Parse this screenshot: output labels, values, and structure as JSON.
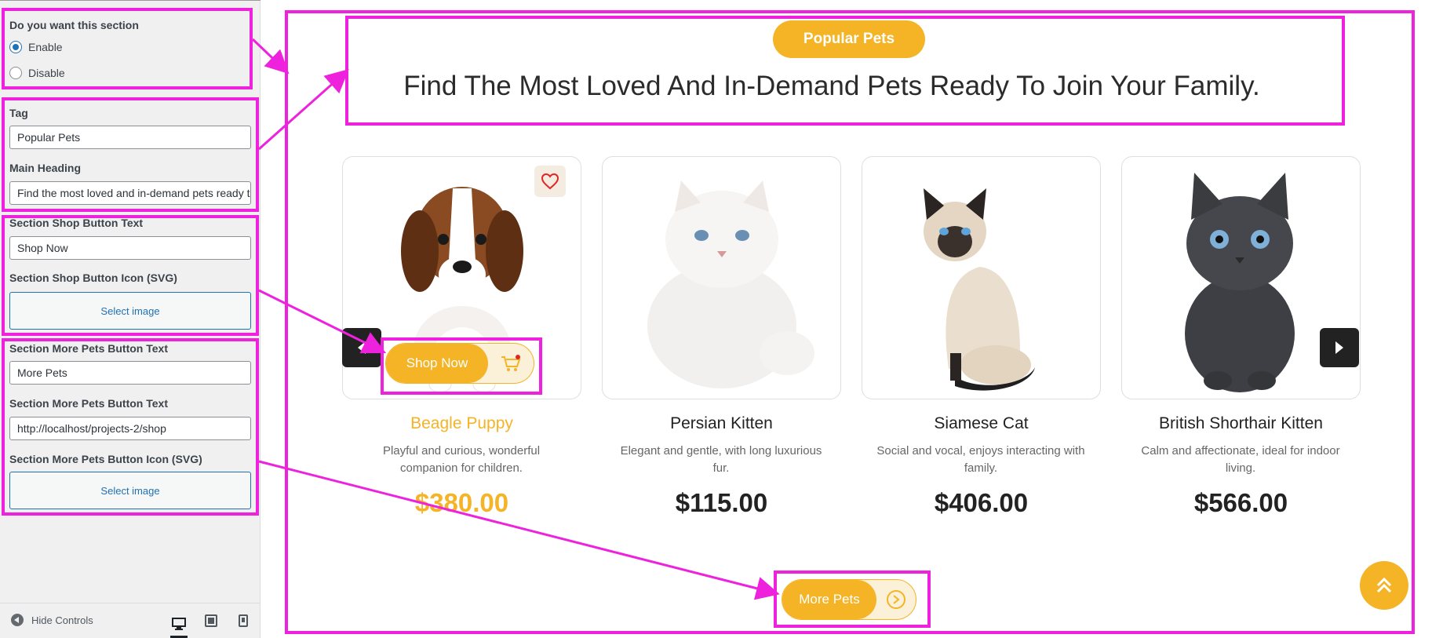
{
  "panel": {
    "section_toggle": {
      "label": "Do you want this section",
      "options": [
        "Enable",
        "Disable"
      ],
      "selected": "Enable"
    },
    "tag": {
      "label": "Tag",
      "value": "Popular Pets"
    },
    "main_heading": {
      "label": "Main Heading",
      "value": "Find the most loved and in-demand pets ready to join your family."
    },
    "shop_button_text": {
      "label": "Section Shop Button Text",
      "value": "Shop Now"
    },
    "shop_button_icon": {
      "label": "Section Shop Button Icon (SVG)",
      "button": "Select image"
    },
    "more_pets_text": {
      "label": "Section More Pets Button Text",
      "value": "More Pets"
    },
    "more_pets_url": {
      "label": "Section More Pets Button Text",
      "value": "http://localhost/projects-2/shop"
    },
    "more_pets_icon": {
      "label": "Section More Pets Button Icon (SVG)",
      "button": "Select image"
    },
    "footer": {
      "hide_controls": "Hide Controls",
      "devices": [
        "desktop-icon",
        "tablet-icon",
        "mobile-icon"
      ]
    }
  },
  "preview": {
    "tag": "Popular Pets",
    "heading": "Find The Most Loved And In-Demand Pets Ready To Join Your Family.",
    "accent_color": "#f5b326",
    "annotation_color": "#ee22dd",
    "products": [
      {
        "name": "Beagle Puppy",
        "desc_line1": "Playful and curious, wonderful",
        "desc_line2": "companion for children.",
        "price": "$380.00",
        "active": true
      },
      {
        "name": "Persian Kitten",
        "desc_line1": "Elegant and gentle, with long luxurious",
        "desc_line2": "fur.",
        "price": "$115.00",
        "active": false
      },
      {
        "name": "Siamese Cat",
        "desc_line1": "Social and vocal, enjoys interacting with",
        "desc_line2": "family.",
        "price": "$406.00",
        "active": false
      },
      {
        "name": "British Shorthair Kitten",
        "desc_line1": "Calm and affectionate, ideal for indoor",
        "desc_line2": "living.",
        "price": "$566.00",
        "active": false
      }
    ],
    "shop_button": {
      "label": "Shop Now",
      "icon": "cart-icon"
    },
    "more_button": {
      "label": "More Pets",
      "icon": "arrow-circle-icon"
    }
  }
}
